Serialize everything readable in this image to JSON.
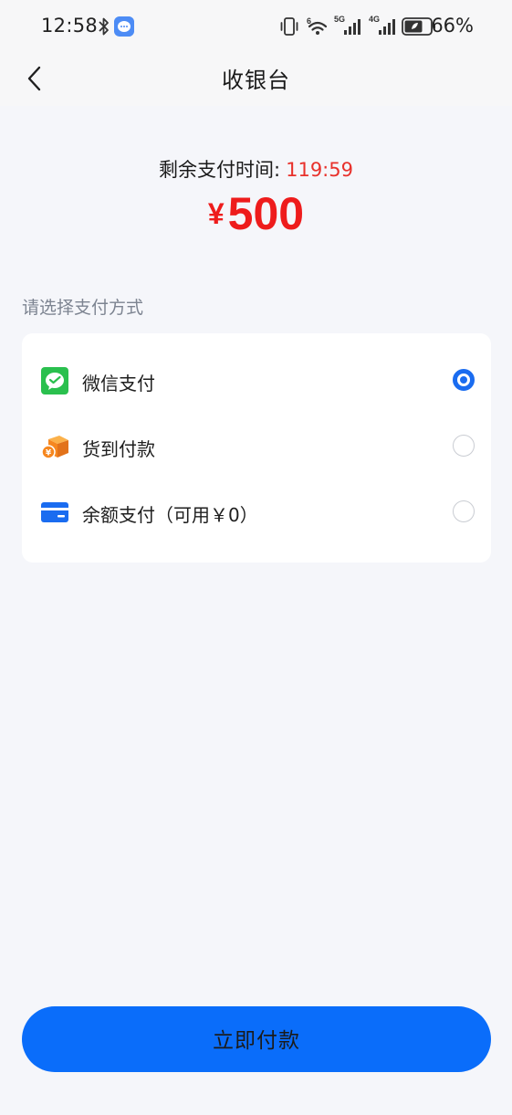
{
  "status_bar": {
    "time": "12:58",
    "battery_percent": "66%",
    "icons": [
      "bluetooth-icon",
      "message-icon",
      "vibrate-icon",
      "wifi-icon",
      "signal-5g-icon",
      "signal-4g-icon",
      "battery-icon"
    ],
    "network_labels": [
      "5G",
      "4G"
    ]
  },
  "nav": {
    "back_icon": "chevron-left-icon",
    "title": "收银台"
  },
  "payment_summary": {
    "timer_label": "剩余支付时间:",
    "timer_value": "119:59",
    "currency_symbol": "¥",
    "amount": "500"
  },
  "payment_methods": {
    "section_title": "请选择支付方式",
    "options": [
      {
        "label": "微信支付",
        "icon": "wechat-pay-icon",
        "selected": true
      },
      {
        "label": "货到付款",
        "icon": "cash-on-delivery-icon",
        "selected": false
      },
      {
        "label": "余额支付（可用￥0）",
        "icon": "balance-card-icon",
        "selected": false
      }
    ]
  },
  "pay_button": {
    "label": "立即付款"
  },
  "colors": {
    "accent": "#0a6dfa",
    "amount_red": "#ee1c1c",
    "timer_red": "#e8312b",
    "wechat_green": "#2ac04e",
    "cod_orange": "#f6871f",
    "background": "#f5f6fa"
  }
}
